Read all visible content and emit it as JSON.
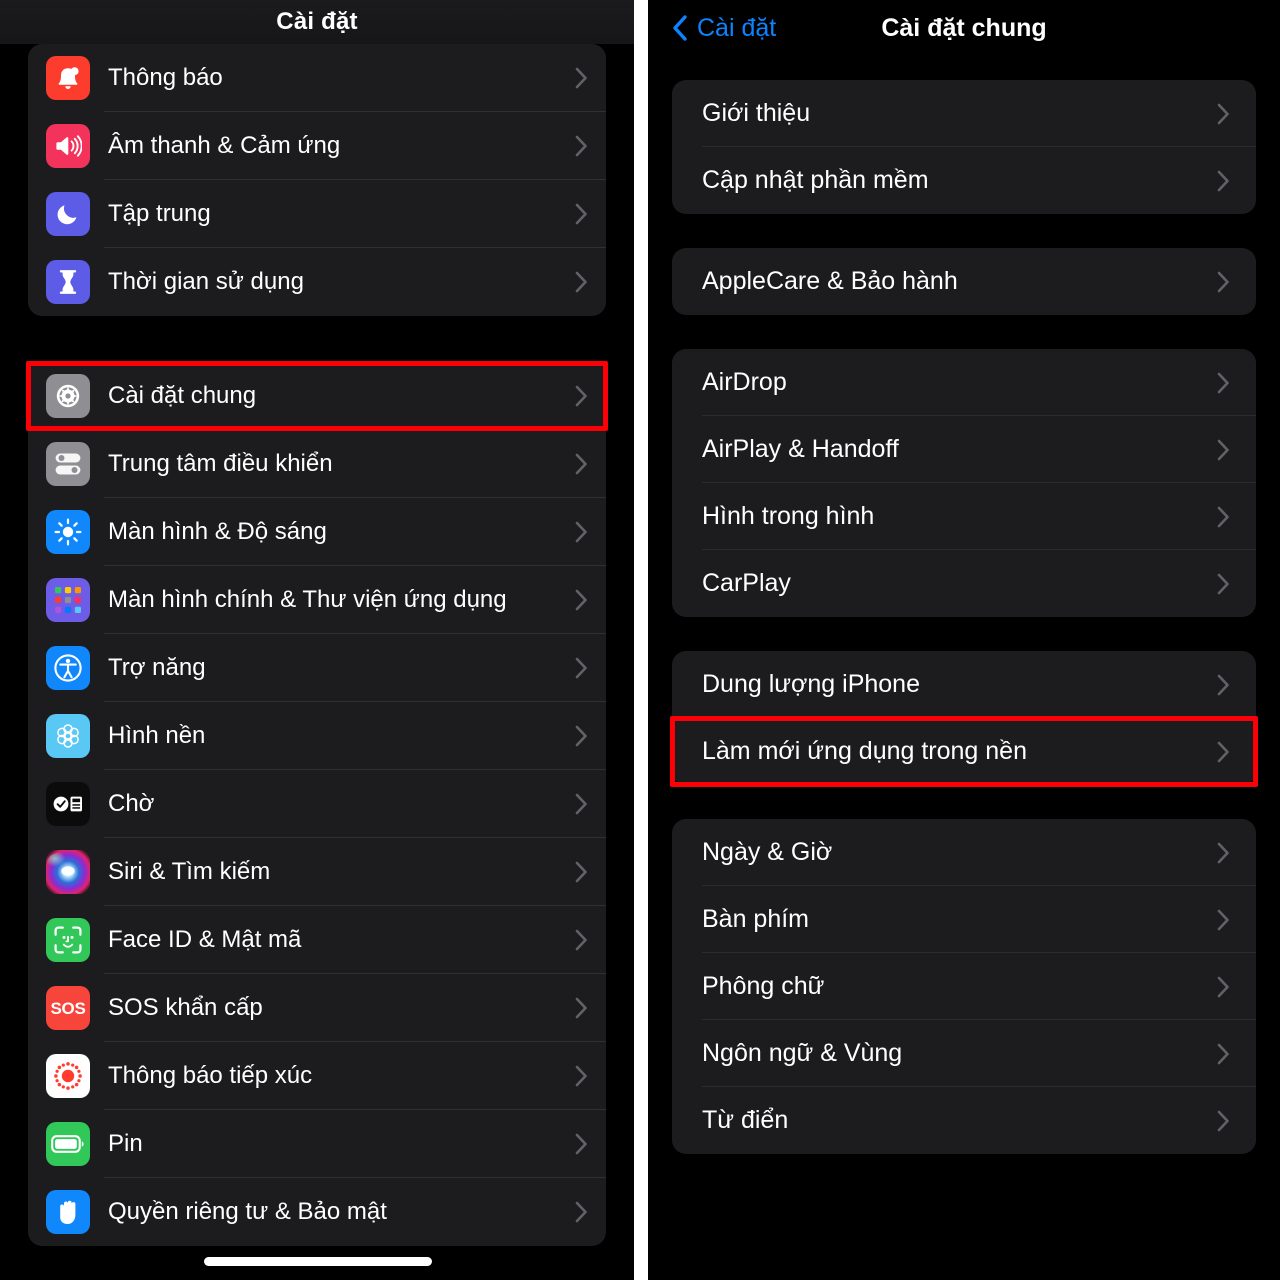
{
  "left_panel": {
    "header": {
      "title": "Cài đặt"
    },
    "groups": [
      {
        "name": "group-notifications",
        "items": [
          {
            "label": "Thông báo",
            "icon": "bell-icon",
            "icon_bg": "#fc3c2d"
          },
          {
            "label": "Âm thanh & Cảm ứng",
            "icon": "speaker-icon",
            "icon_bg": "#f3335b"
          },
          {
            "label": "Tập trung",
            "icon": "moon-icon",
            "icon_bg": "#5d5ce6"
          },
          {
            "label": "Thời gian sử dụng",
            "icon": "hourglass-icon",
            "icon_bg": "#5d5ce6"
          }
        ]
      },
      {
        "name": "group-general",
        "items": [
          {
            "label": "Cài đặt chung",
            "icon": "gear-icon",
            "icon_bg": "#8e8e93",
            "highlighted": true
          },
          {
            "label": "Trung tâm điều khiển",
            "icon": "toggles-icon",
            "icon_bg": "#8e8e93"
          },
          {
            "label": "Màn hình & Độ sáng",
            "icon": "brightness-icon",
            "icon_bg": "#1088fb"
          },
          {
            "label": "Màn hình chính & Thư viện ứng dụng",
            "icon": "app-grid-icon",
            "icon_bg": "#6c5ce7"
          },
          {
            "label": "Trợ năng",
            "icon": "accessibility-icon",
            "icon_bg": "#1088fb"
          },
          {
            "label": "Hình nền",
            "icon": "flower-icon",
            "icon_bg": "#5ac8f5"
          },
          {
            "label": "Chờ",
            "icon": "standby-icon",
            "icon_bg": "#0b0b0c"
          },
          {
            "label": "Siri & Tìm kiếm",
            "icon": "siri-icon",
            "icon_bg": "#1a1a2e"
          },
          {
            "label": "Face ID & Mật mã",
            "icon": "faceid-icon",
            "icon_bg": "#31c859"
          },
          {
            "label": "SOS khẩn cấp",
            "icon": "sos-icon",
            "icon_bg": "#f8453b"
          },
          {
            "label": "Thông báo tiếp xúc",
            "icon": "exposure-icon",
            "icon_bg": "#fefefe"
          },
          {
            "label": "Pin",
            "icon": "battery-icon",
            "icon_bg": "#31c859"
          },
          {
            "label": "Quyền riêng tư & Bảo mật",
            "icon": "hand-icon",
            "icon_bg": "#1088fb"
          }
        ]
      }
    ]
  },
  "right_panel": {
    "header": {
      "back_label": "Cài đặt",
      "title": "Cài đặt chung"
    },
    "groups": [
      {
        "name": "group-about",
        "items": [
          {
            "label": "Giới thiệu"
          },
          {
            "label": "Cập nhật phần mềm"
          }
        ]
      },
      {
        "name": "group-applecare",
        "items": [
          {
            "label": "AppleCare & Bảo hành"
          }
        ]
      },
      {
        "name": "group-sharing",
        "items": [
          {
            "label": "AirDrop"
          },
          {
            "label": "AirPlay & Handoff"
          },
          {
            "label": "Hình trong hình"
          },
          {
            "label": "CarPlay"
          }
        ]
      },
      {
        "name": "group-storage",
        "items": [
          {
            "label": "Dung lượng iPhone"
          },
          {
            "label": "Làm mới ứng dụng trong nền",
            "highlighted": true
          }
        ]
      },
      {
        "name": "group-locale",
        "items": [
          {
            "label": "Ngày & Giờ"
          },
          {
            "label": "Bàn phím"
          },
          {
            "label": "Phông chữ"
          },
          {
            "label": "Ngôn ngữ & Vùng"
          },
          {
            "label": "Từ điển"
          }
        ]
      }
    ]
  },
  "annotations": {
    "highlight_color": "#fb0007",
    "left_highlight_target": "Cài đặt chung",
    "right_highlight_target": "Làm mới ứng dụng trong nền"
  },
  "theme": {
    "background": "#000000",
    "card_background": "#1c1c1e",
    "accent_blue": "#0a84ff",
    "separator": "#303032",
    "text_primary": "#ffffff",
    "chevron_gray": "#8e8e93"
  }
}
